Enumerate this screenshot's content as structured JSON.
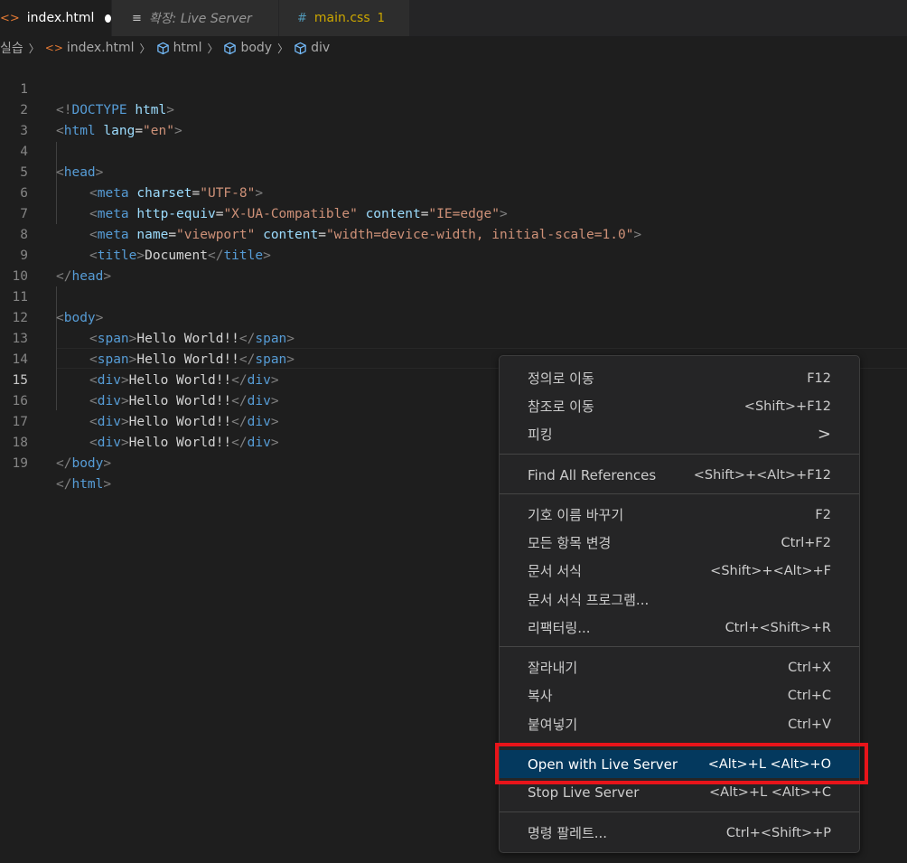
{
  "tabs": [
    {
      "icon": "<>",
      "label": "index.html",
      "modified": true
    },
    {
      "icon": "≡",
      "label": "확장: Live Server"
    },
    {
      "icon": "#",
      "label": "main.css",
      "badge": "1"
    }
  ],
  "breadcrumb": [
    "실습",
    "index.html",
    "html",
    "body",
    "div"
  ],
  "line_numbers": [
    "1",
    "2",
    "3",
    "4",
    "5",
    "6",
    "7",
    "8",
    "9",
    "10",
    "11",
    "12",
    "13",
    "14",
    "15",
    "16",
    "17",
    "18",
    "19"
  ],
  "code": {
    "l1": [
      "<!",
      "DOCTYPE",
      " ",
      "html",
      ">"
    ],
    "l2": [
      "<",
      "html",
      " ",
      "lang",
      "=",
      "\"en\"",
      ">"
    ],
    "l4": [
      "<",
      "head",
      ">"
    ],
    "l5": [
      "<",
      "meta",
      " ",
      "charset",
      "=",
      "\"UTF-8\"",
      ">"
    ],
    "l6": [
      "<",
      "meta",
      " ",
      "http-equiv",
      "=",
      "\"X-UA-Compatible\"",
      " ",
      "content",
      "=",
      "\"IE=edge\"",
      ">"
    ],
    "l7": [
      "<",
      "meta",
      " ",
      "name",
      "=",
      "\"viewport\"",
      " ",
      "content",
      "=",
      "\"width=device-width, initial-scale=1.0\"",
      ">"
    ],
    "l8": [
      "<",
      "title",
      ">",
      "Document",
      "</",
      "title",
      ">"
    ],
    "l9": [
      "</",
      "head",
      ">"
    ],
    "l11": [
      "<",
      "body",
      ">"
    ],
    "l12": [
      "<",
      "span",
      ">",
      "Hello World!!",
      "</",
      "span",
      ">"
    ],
    "l13": [
      "<",
      "span",
      ">",
      "Hello World!!",
      "</",
      "span",
      ">"
    ],
    "l14": [
      "<",
      "div",
      ">",
      "Hello World!!",
      "</",
      "div",
      ">"
    ],
    "l15": [
      "<",
      "div",
      ">",
      "Hello World!!",
      "</",
      "div",
      ">"
    ],
    "l16": [
      "<",
      "div",
      ">",
      "Hello World!!",
      "</",
      "div",
      ">"
    ],
    "l17": [
      "<",
      "div",
      ">",
      "Hello World!!",
      "</",
      "div",
      ">"
    ],
    "l18": [
      "</",
      "body",
      ">"
    ],
    "l19": [
      "</",
      "html",
      ">"
    ]
  },
  "menu": {
    "items": [
      {
        "label": "정의로 이동",
        "shortcut": "F12"
      },
      {
        "label": "참조로 이동",
        "shortcut": "<Shift>+F12"
      },
      {
        "label": "피킹",
        "shortcut": ">"
      },
      {
        "label": "Find All References",
        "shortcut": "<Shift>+<Alt>+F12"
      },
      {
        "label": "기호 이름 바꾸기",
        "shortcut": "F2"
      },
      {
        "label": "모든 항목 변경",
        "shortcut": "Ctrl+F2"
      },
      {
        "label": "문서 서식",
        "shortcut": "<Shift>+<Alt>+F"
      },
      {
        "label": "문서 서식 프로그램...",
        "shortcut": ""
      },
      {
        "label": "리팩터링...",
        "shortcut": "Ctrl+<Shift>+R"
      },
      {
        "label": "잘라내기",
        "shortcut": "Ctrl+X"
      },
      {
        "label": "복사",
        "shortcut": "Ctrl+C"
      },
      {
        "label": "붙여넣기",
        "shortcut": "Ctrl+V"
      },
      {
        "label": "Open with Live Server",
        "shortcut": "<Alt>+L <Alt>+O"
      },
      {
        "label": "Stop Live Server",
        "shortcut": "<Alt>+L <Alt>+C"
      },
      {
        "label": "명령 팔레트...",
        "shortcut": "Ctrl+<Shift>+P"
      }
    ]
  },
  "colors": {
    "highlight_box": "#e8141a",
    "menu_highlight": "#04395e",
    "tag": "#569cd6",
    "attr": "#9cdcfe",
    "string": "#ce9178"
  }
}
